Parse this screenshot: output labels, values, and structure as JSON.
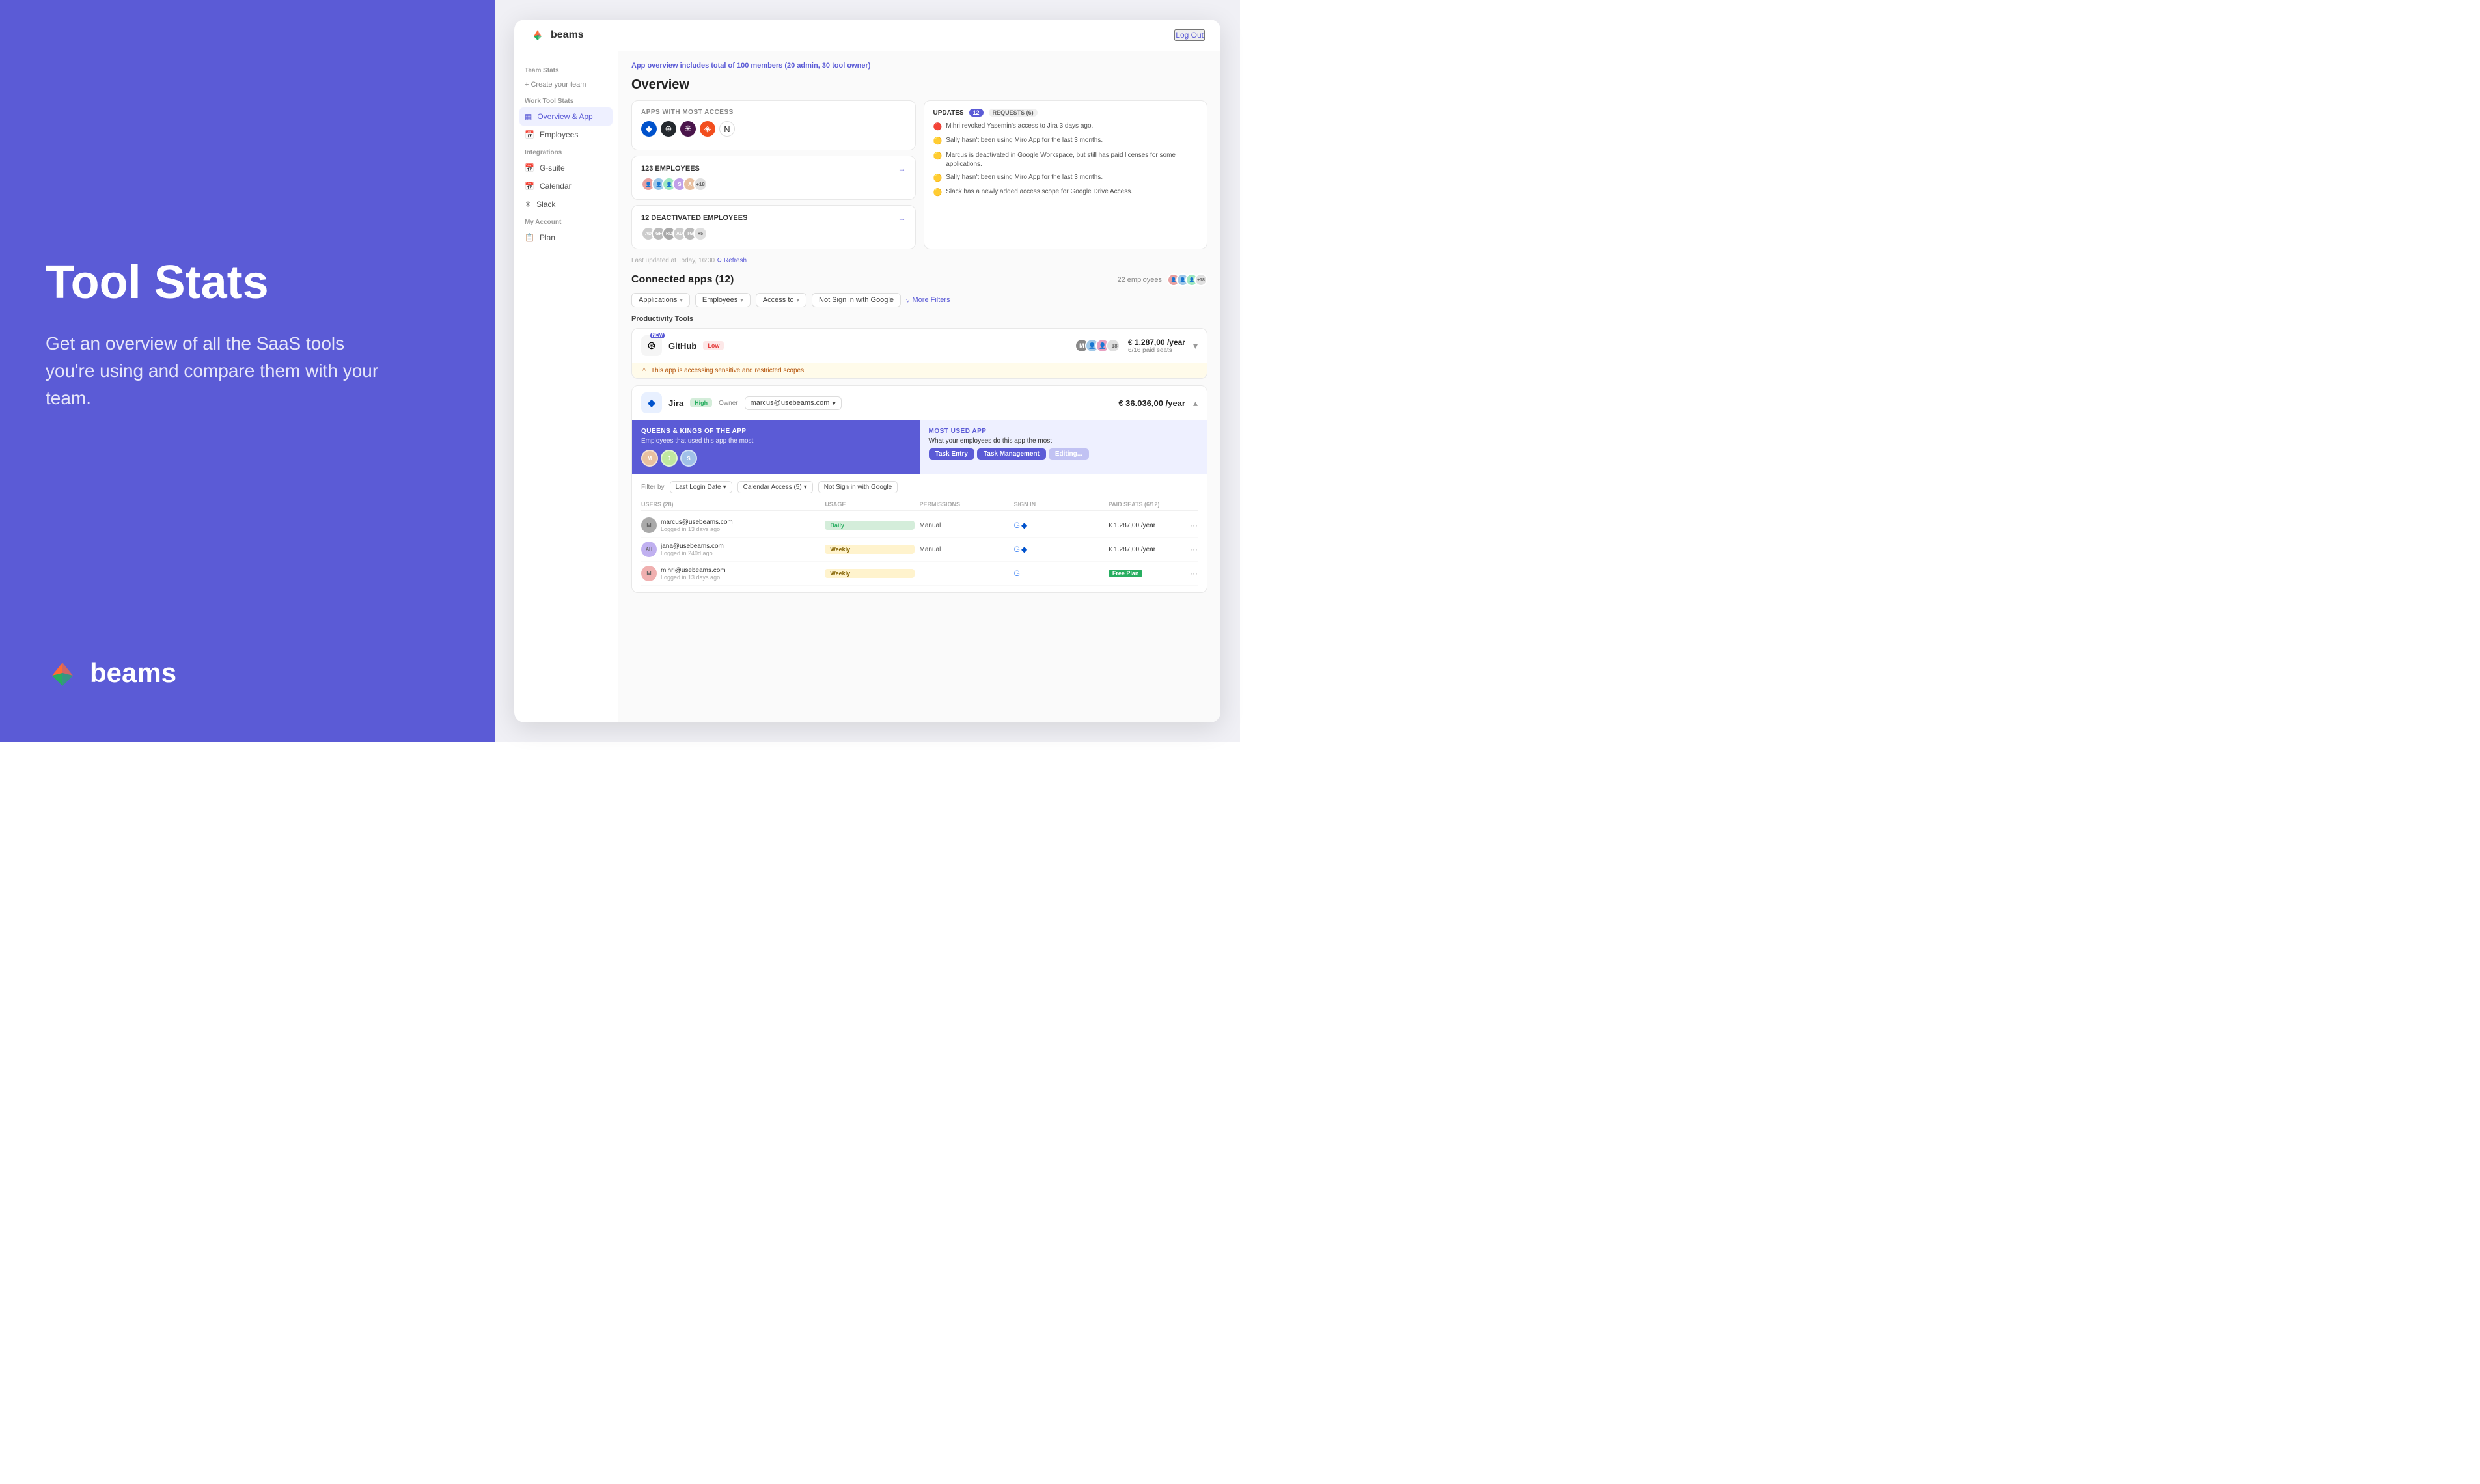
{
  "left": {
    "title": "Tool Stats",
    "subtitle": "Get an overview of all the SaaS tools you're using and compare them with your team.",
    "logo_text": "beams"
  },
  "app": {
    "brand": "beams",
    "logout": "Log Out",
    "notice": "App overview includes ",
    "notice_highlight": "total of 100 members (20 admin, 30 tool owner)"
  },
  "sidebar": {
    "team_stats_label": "Team Stats",
    "create_team": "+ Create your team",
    "work_tool_stats_label": "Work Tool Stats",
    "overview_app": "Overview & App",
    "employees": "Employees",
    "integrations_label": "Integrations",
    "gsuite": "G-suite",
    "calendar": "Calendar",
    "slack": "Slack",
    "my_account_label": "My Account",
    "plan": "Plan"
  },
  "overview": {
    "title": "Overview",
    "apps_with_most_access": "APPS WITH MOST ACCESS",
    "employees_count": "123 EMPLOYEES",
    "deactivated_count": "12 DEACTIVATED EMPLOYEES",
    "updates_title": "UPDATES",
    "updates_count": "12",
    "requests_label": "REQUESTS (6)",
    "last_updated": "Last updated at Today, 16:30",
    "refresh": "↻ Refresh",
    "updates": [
      {
        "icon": "🔴",
        "text": "Mihri revoked Yasemin's access to Jira 3 days ago."
      },
      {
        "icon": "🟡",
        "text": "Sally hasn't been using Miro App for the last 3 months."
      },
      {
        "icon": "🟡",
        "text": "Marcus is deactivated in Google Workspace, but still has paid licenses for some applications."
      },
      {
        "icon": "🟡",
        "text": "Sally hasn't been using Miro App for the last 3 months."
      },
      {
        "icon": "🟡",
        "text": "Slack has a newly added access scope for Google Drive Access."
      }
    ],
    "deactivated_avatars": [
      "AD",
      "GF",
      "RD",
      "AD",
      "TG",
      "+5"
    ]
  },
  "connected_apps": {
    "title": "Connected apps (12)",
    "employee_count": "22 employees",
    "more_count": "+18",
    "filters": {
      "applications": "Applications",
      "employees": "Employees",
      "access_to": "Access to",
      "not_sign_google": "Not Sign in with Google",
      "more_filters": "More Filters"
    },
    "productivity_label": "Productivity Tools"
  },
  "github": {
    "name": "GitHub",
    "badge": "NEW",
    "risk": "Low",
    "price": "€ 1.287,00 /year",
    "seats": "6/16 paid seats",
    "owner_avatars": [
      "M"
    ],
    "warning": "This app is accessing sensitive and restricted scopes."
  },
  "jira": {
    "name": "Jira",
    "risk": "High",
    "owner_label": "Owner",
    "owner_email": "marcus@usebeams.com",
    "price": "€ 36.036,00 /year",
    "queens_title": "QUEENS & KINGS OF THE APP",
    "queens_subtitle": "Employees that used this app the most",
    "most_used_title": "MOST USED APP",
    "most_used_subtitle": "What your employees do this app the most",
    "tags": [
      "Task Entry",
      "Task Management",
      "Editing..."
    ],
    "filter_label": "Filter by",
    "filter_login": "Last Login Date",
    "filter_calendar": "Calendar Access (5)",
    "filter_google": "Not Sign in with Google",
    "users_section_title": "Users (28)",
    "table_headers": [
      "Users (28)",
      "Usage",
      "Permissions",
      "Sign in",
      "Paid Seats (6/12)"
    ],
    "users": [
      {
        "email": "marcus@usebeams.com",
        "login": "Logged in 13 days ago",
        "usage": "Daily",
        "usage_type": "daily",
        "permissions": "Manual",
        "price": "€ 1.287,00 /year",
        "avatar_text": "M",
        "avatar_color": "#888"
      },
      {
        "email": "jana@usebeams.com",
        "login": "Logged in 240d ago",
        "usage": "Weekly",
        "usage_type": "weekly",
        "permissions": "Manual",
        "price": "€ 1.287,00 /year",
        "avatar_text": "AH",
        "avatar_color": "#c0b0f0"
      },
      {
        "email": "mihri@usebeams.com",
        "login": "Logged in 13 days ago",
        "usage": "Weekly",
        "usage_type": "weekly",
        "permissions": "",
        "price": "Free Plan",
        "price_type": "free",
        "avatar_text": "M2",
        "avatar_color": "#f0b0b0"
      }
    ]
  }
}
